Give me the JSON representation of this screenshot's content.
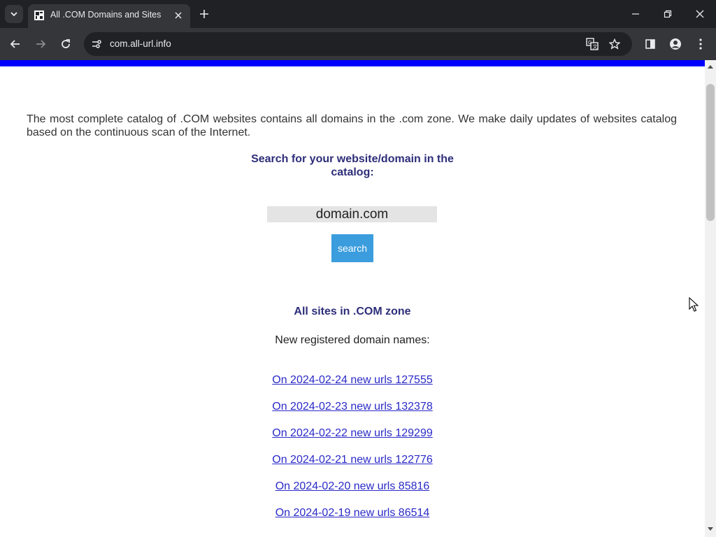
{
  "browser": {
    "tab": {
      "title": "All .COM Domains and Sites"
    },
    "address_bar": {
      "url": "com.all-url.info"
    }
  },
  "page": {
    "intro_text": "The most complete catalog of .COM websites contains all domains in the .com zone. We make daily updates of websites catalog based on the continuous scan of the Internet.",
    "search": {
      "heading": "Search for your website/domain in the catalog:",
      "input_value": "domain.com",
      "button_label": "search"
    },
    "zone_heading": "All sites in .COM zone",
    "new_registered_label": "New registered domain names:",
    "daily_links": [
      "On 2024-02-24 new urls 127555",
      "On 2024-02-23 new urls 132378",
      "On 2024-02-22 new urls 129299",
      "On 2024-02-21 new urls 122776",
      "On 2024-02-20 new urls 85816",
      "On 2024-02-19 new urls 86514"
    ]
  },
  "colors": {
    "browser_frame": "#202124",
    "toolbar": "#35363a",
    "top_stripe": "#0000ff",
    "heading": "#2e2e7a",
    "link": "#2a2ac8",
    "search_button": "#3b9ddd"
  },
  "icons": [
    "tab-search-icon",
    "favicon-icon",
    "close-icon",
    "plus-icon",
    "minimize-icon",
    "restore-icon",
    "back-arrow-icon",
    "forward-arrow-icon",
    "reload-icon",
    "site-info-icon",
    "translate-icon",
    "star-icon",
    "side-panel-icon",
    "profile-icon",
    "kebab-menu-icon",
    "mouse-cursor-icon"
  ]
}
